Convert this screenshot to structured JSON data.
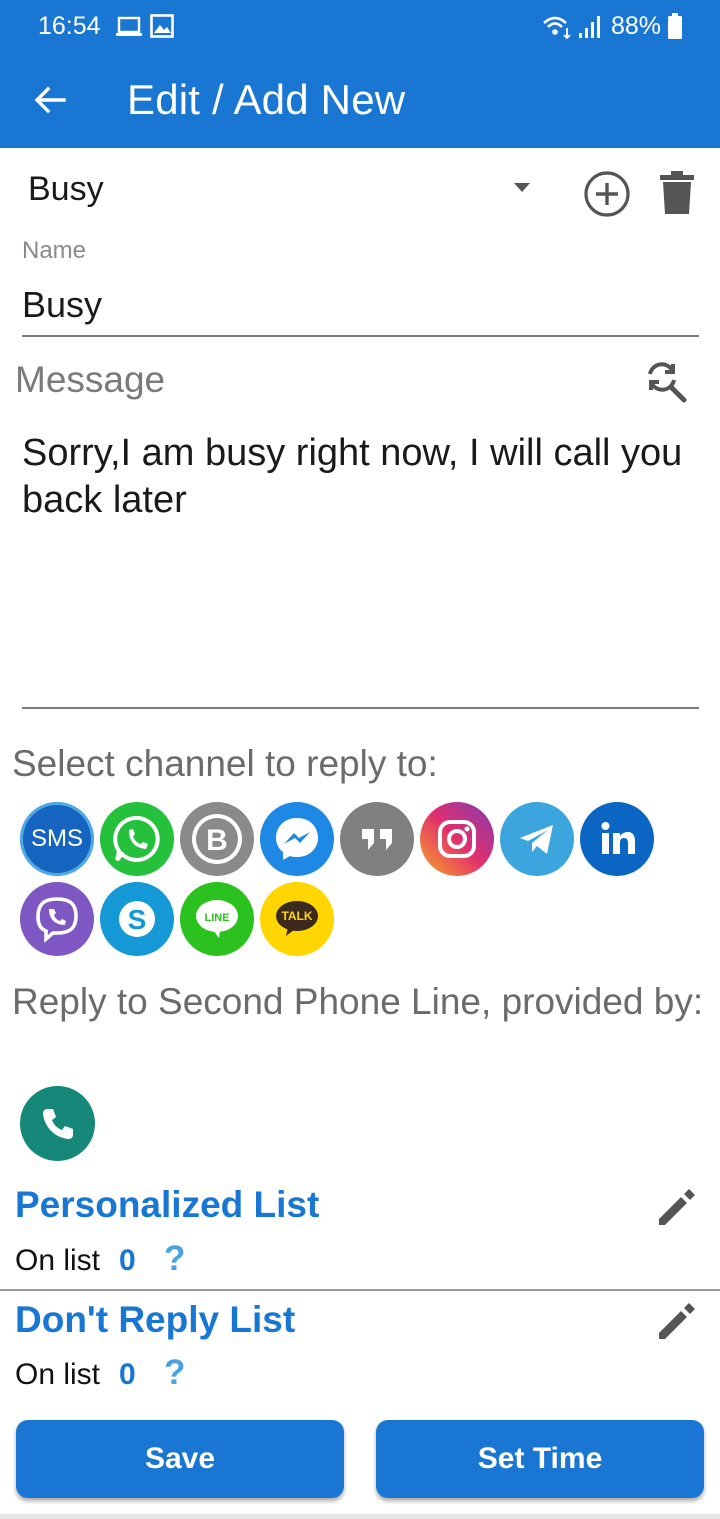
{
  "status_bar": {
    "time": "16:54",
    "battery": "88%"
  },
  "header": {
    "title": "Edit / Add New"
  },
  "spinner": {
    "selected": "Busy"
  },
  "name_field": {
    "label": "Name",
    "value": "Busy"
  },
  "message_field": {
    "label": "Message",
    "value": "Sorry,I am busy right now, I will call you back later"
  },
  "channels": {
    "label": "Select channel to reply to:",
    "items": [
      {
        "name": "SMS",
        "color": "#1565c0"
      },
      {
        "name": "WhatsApp",
        "color": "#25c03c"
      },
      {
        "name": "WhatsApp Business",
        "color": "#8a8a8a"
      },
      {
        "name": "Messenger",
        "color": "#1e88e5"
      },
      {
        "name": "Hangouts",
        "color": "#808080"
      },
      {
        "name": "Instagram",
        "color": "#c13584"
      },
      {
        "name": "Telegram",
        "color": "#3da5de"
      },
      {
        "name": "LinkedIn",
        "color": "#0a66c2"
      },
      {
        "name": "Viber",
        "color": "#7e57c2"
      },
      {
        "name": "Skype",
        "color": "#1598d6"
      },
      {
        "name": "LINE",
        "color": "#2bc21f"
      },
      {
        "name": "KakaoTalk",
        "color": "#ffd600"
      }
    ],
    "sms_text": "SMS",
    "line_text": "LINE",
    "talk_text": "TALK"
  },
  "second_line": {
    "label": "Reply to Second Phone Line, provided by:"
  },
  "personalized_list": {
    "title": "Personalized List",
    "on_list_label": "On list",
    "count": "0",
    "help": "?"
  },
  "dont_reply_list": {
    "title": "Don't Reply List",
    "on_list_label": "On list",
    "count": "0",
    "help": "?"
  },
  "buttons": {
    "save": "Save",
    "set_time": "Set Time"
  }
}
